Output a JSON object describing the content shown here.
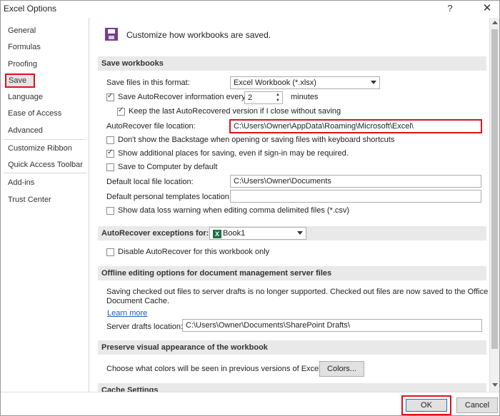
{
  "window": {
    "title": "Excel Options",
    "help": "?",
    "close": "✕"
  },
  "sidebar": {
    "items": [
      "General",
      "Formulas",
      "Proofing",
      "Save",
      "Language",
      "Ease of Access",
      "Advanced",
      "Customize Ribbon",
      "Quick Access Toolbar",
      "Add-ins",
      "Trust Center"
    ],
    "selected": "Save"
  },
  "header": {
    "text": "Customize how workbooks are saved."
  },
  "save_workbooks": {
    "title": "Save workbooks",
    "format_label": "Save files in this format:",
    "format_value": "Excel Workbook (*.xlsx)",
    "autorecover_label": "Save AutoRecover information every",
    "autorecover_checked": true,
    "autorecover_minutes": "2",
    "minutes_label": "minutes",
    "keep_last_label": "Keep the last AutoRecovered version if I close without saving",
    "keep_last_checked": true,
    "autorecover_location_label": "AutoRecover file location:",
    "autorecover_location_value": "C:\\Users\\Owner\\AppData\\Roaming\\Microsoft\\Excel\\",
    "backstage_label": "Don't show the Backstage when opening or saving files with keyboard shortcuts",
    "backstage_checked": false,
    "additional_places_label": "Show additional places for saving, even if sign-in may be required.",
    "additional_places_checked": true,
    "save_to_computer_label": "Save to Computer by default",
    "save_to_computer_checked": false,
    "default_local_label": "Default local file location:",
    "default_local_value": "C:\\Users\\Owner\\Documents",
    "default_templates_label": "Default personal templates location:",
    "default_templates_value": "",
    "data_loss_label": "Show data loss warning when editing comma delimited files (*.csv)",
    "data_loss_checked": false
  },
  "autorecover_exceptions": {
    "title": "AutoRecover exceptions for:",
    "workbook": "Book1",
    "disable_label": "Disable AutoRecover for this workbook only",
    "disable_checked": false
  },
  "offline_editing": {
    "title": "Offline editing options for document management server files",
    "description_line1": "Saving checked out files to server drafts is no longer supported. Checked out files are now saved to the Office",
    "description_line2": "Document Cache.",
    "learn_more": "Learn more",
    "server_drafts_label": "Server drafts location:",
    "server_drafts_value": "C:\\Users\\Owner\\Documents\\SharePoint Drafts\\"
  },
  "preserve_visual": {
    "title": "Preserve visual appearance of the workbook",
    "colors_label": "Choose what colors will be seen in previous versions of Excel:",
    "colors_button": "Colors..."
  },
  "cache_settings": {
    "title": "Cache Settings"
  },
  "footer": {
    "ok": "OK",
    "cancel": "Cancel"
  },
  "colors": {
    "highlight_red": "#d9141c",
    "excel_green": "#1d7044",
    "save_icon_purple": "#7a3b8b",
    "link_blue": "#1e5bb8"
  }
}
